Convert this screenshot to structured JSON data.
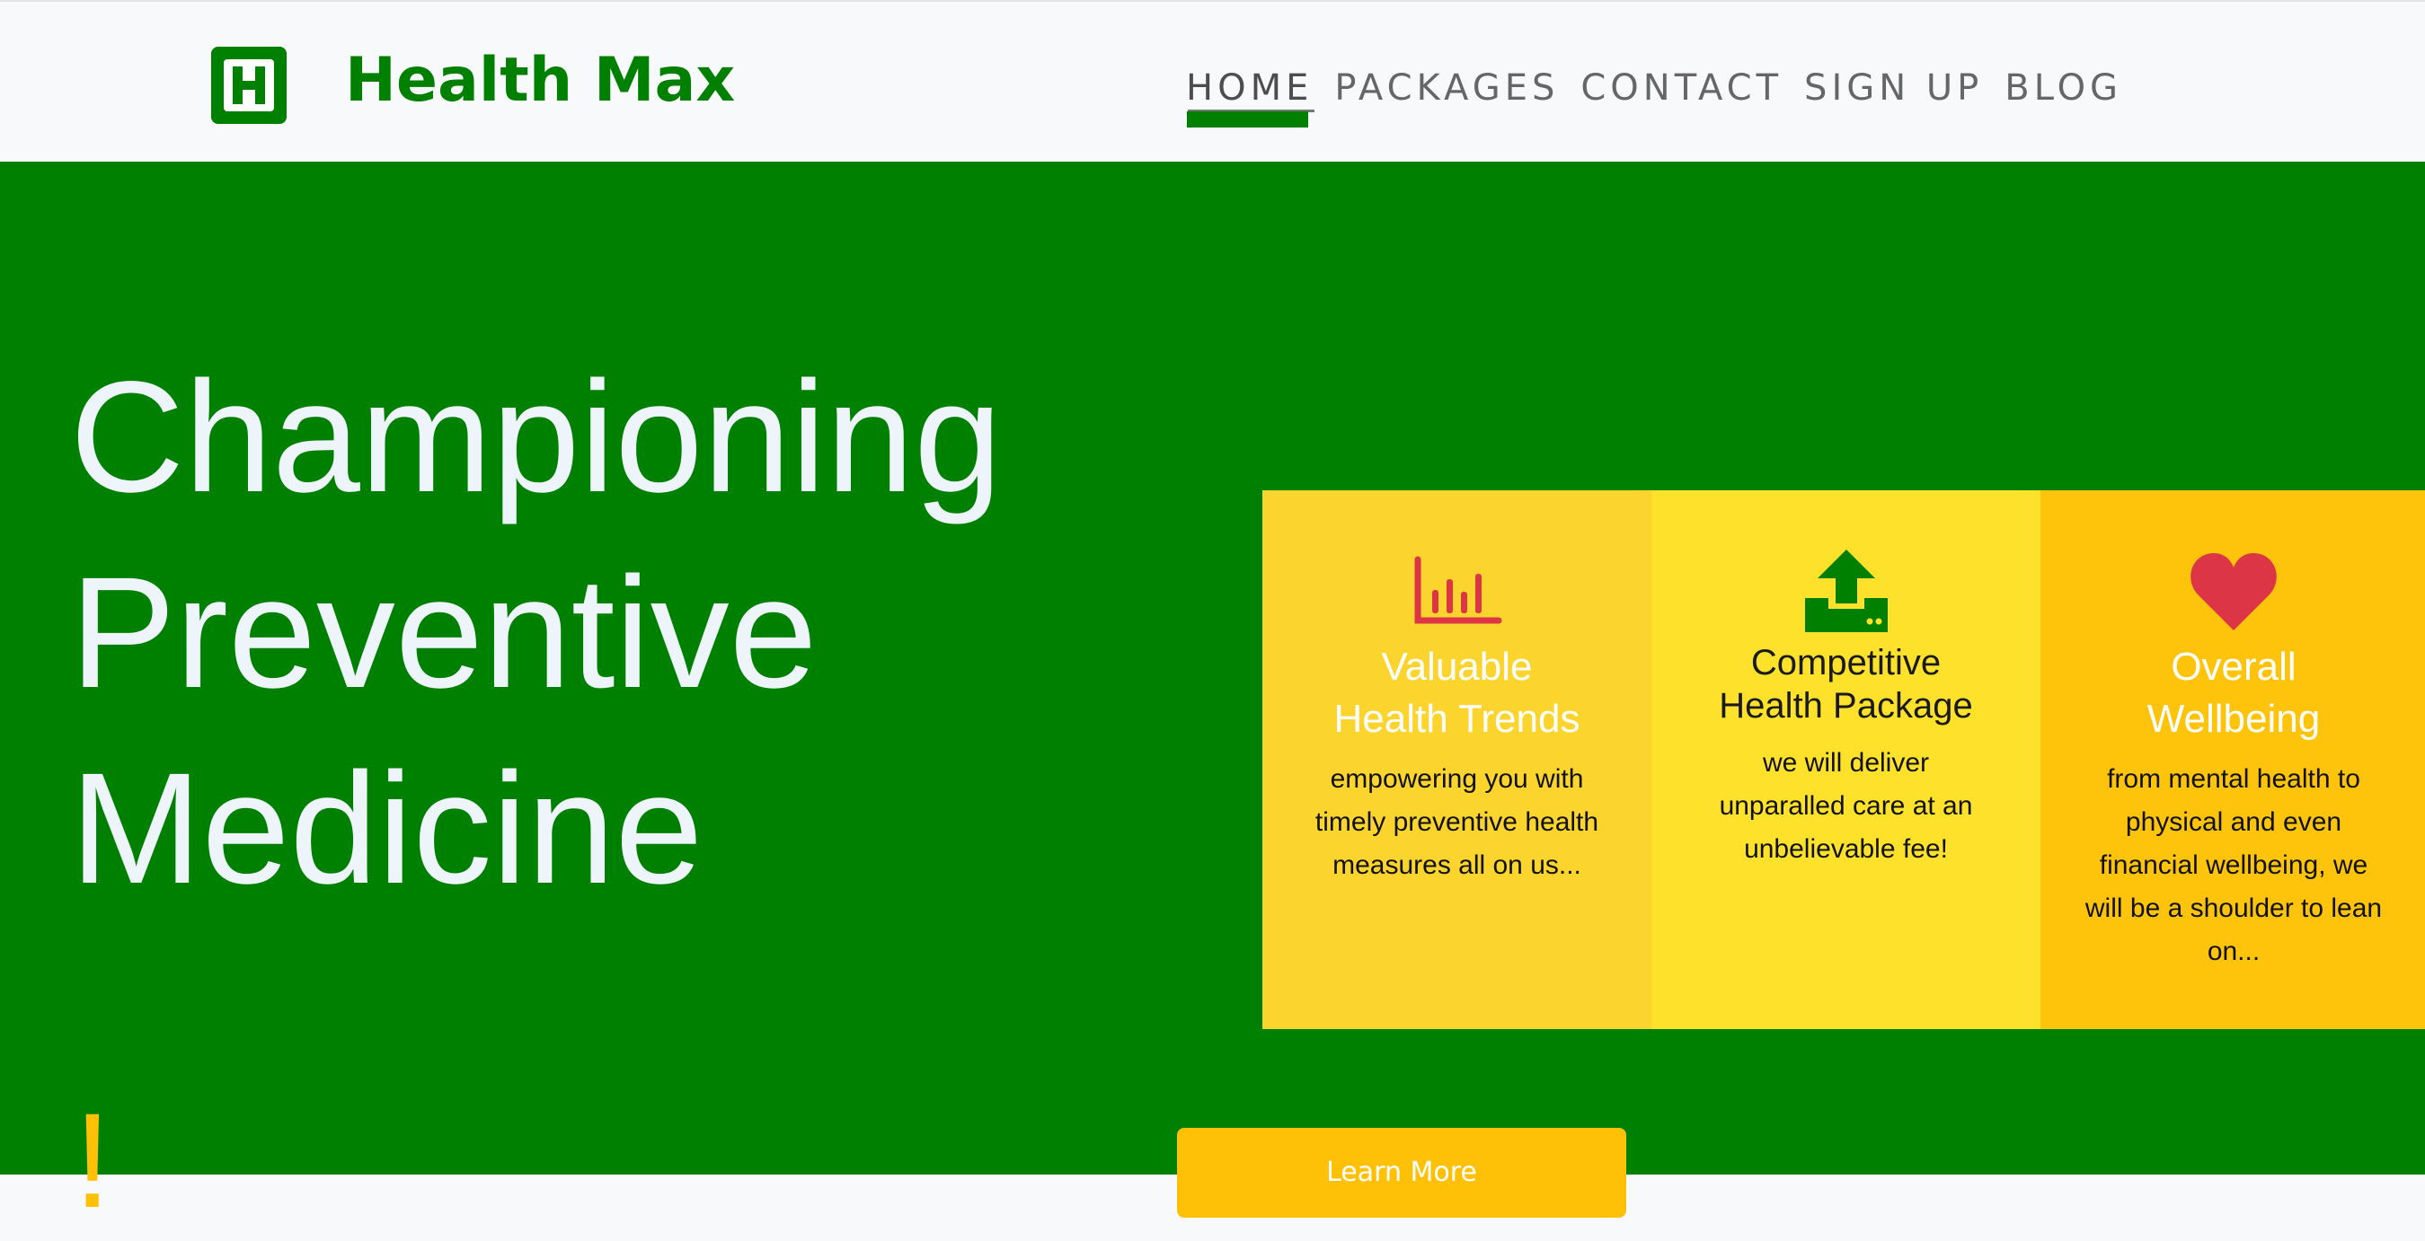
{
  "brand": {
    "logo_letter": "H",
    "name": "Health Max"
  },
  "nav": {
    "items": [
      {
        "label": "HOME",
        "active": true
      },
      {
        "label": "PACKAGES",
        "active": false
      },
      {
        "label": "CONTACT",
        "active": false
      },
      {
        "label": "SIGN UP",
        "active": false
      },
      {
        "label": "BLOG",
        "active": false
      }
    ]
  },
  "hero": {
    "title_lines": [
      "Championing",
      "Preventive",
      "Medicine"
    ],
    "exclamation": "!",
    "cta_label": "Learn More"
  },
  "cards": [
    {
      "icon": "bar-chart-icon",
      "title_lines": [
        "Valuable",
        "Health Trends"
      ],
      "text": "empowering you with timely preventive health measures all on us..."
    },
    {
      "icon": "upload-icon",
      "title_lines": [
        "Competitive",
        "Health Package"
      ],
      "text": "we will deliver unparalled care at an unbelievable fee!"
    },
    {
      "icon": "heart-icon",
      "title_lines": [
        "Overall",
        "Wellbeing"
      ],
      "text": "from mental health to physical and even financial wellbeing, we will be a shoulder to lean on..."
    }
  ],
  "colors": {
    "brand_green": "#008000",
    "accent_yellow": "#ffc107",
    "icon_red": "#dc3545",
    "hero_text": "#eef5fa"
  }
}
